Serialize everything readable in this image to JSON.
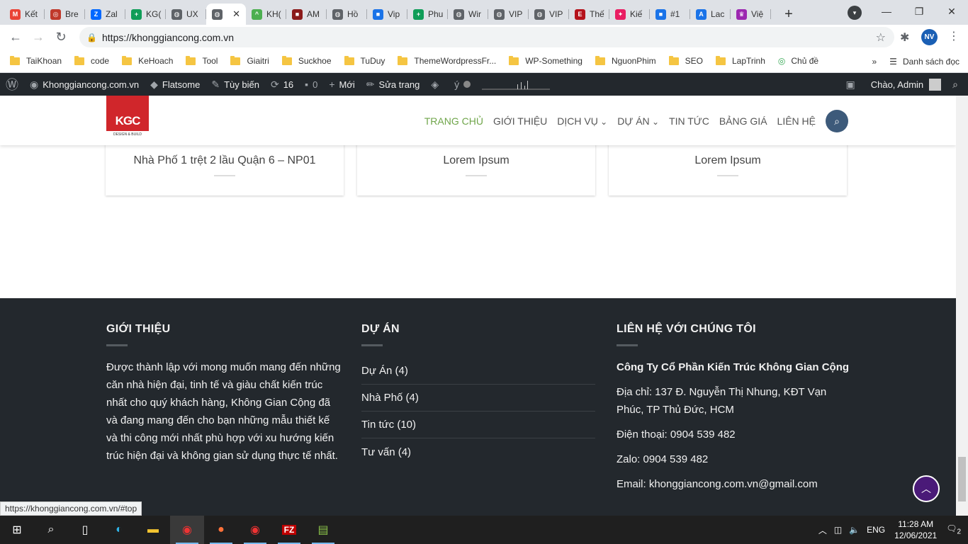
{
  "browser": {
    "tabs": [
      {
        "label": "Kết",
        "color": "#ea4335",
        "glyph": "M"
      },
      {
        "label": "Bre",
        "color": "#c0392b",
        "glyph": "◎"
      },
      {
        "label": "Zal",
        "color": "#0068ff",
        "glyph": "Z"
      },
      {
        "label": "KG(",
        "color": "#0f9d58",
        "glyph": "+"
      },
      {
        "label": "UX",
        "color": "#5f6368",
        "glyph": "◍"
      },
      {
        "label": "",
        "color": "#5f6368",
        "glyph": "◍",
        "active": true
      },
      {
        "label": "KH(",
        "color": "#4caf50",
        "glyph": "^"
      },
      {
        "label": "AM",
        "color": "#8b1a1a",
        "glyph": "■"
      },
      {
        "label": "Hồ",
        "color": "#5f6368",
        "glyph": "◍"
      },
      {
        "label": "Vip",
        "color": "#1a73e8",
        "glyph": "■"
      },
      {
        "label": "Phu",
        "color": "#0f9d58",
        "glyph": "+"
      },
      {
        "label": "Wir",
        "color": "#5f6368",
        "glyph": "◍"
      },
      {
        "label": "VIP",
        "color": "#5f6368",
        "glyph": "◍"
      },
      {
        "label": "VIP",
        "color": "#5f6368",
        "glyph": "◍"
      },
      {
        "label": "Thế",
        "color": "#b5121b",
        "glyph": "E"
      },
      {
        "label": "Kiế",
        "color": "#e91e63",
        "glyph": "✦"
      },
      {
        "label": "#1",
        "color": "#1a73e8",
        "glyph": "■"
      },
      {
        "label": "Lac",
        "color": "#1a73e8",
        "glyph": "A"
      },
      {
        "label": "Việ",
        "color": "#9c27b0",
        "glyph": "♛"
      }
    ],
    "url": "https://khonggiancong.com.vn",
    "profile_initials": "NV",
    "bookmarks": [
      "TaiKhoan",
      "code",
      "KeHoach",
      "Tool",
      "Giaitri",
      "Suckhoe",
      "TuDuy",
      "ThemeWordpressFr...",
      "WP-Something",
      "NguonPhim",
      "SEO",
      "LapTrinh"
    ],
    "bookmark_special": "Chủ đề",
    "reading_list": "Danh sách đọc",
    "status_url": "https://khonggiancong.com.vn/#top"
  },
  "adminbar": {
    "site": "Khonggiancong.com.vn",
    "theme": "Flatsome",
    "customize": "Tùy biến",
    "updates": "16",
    "comments": "0",
    "new": "Mới",
    "edit": "Sửa trang",
    "greeting": "Chào, Admin"
  },
  "site": {
    "logo_text": "KGC",
    "logo_tag": "DESIGN & BUILD",
    "nav": [
      "TRANG CHỦ",
      "GIỚI THIỆU",
      "DỊCH VỤ",
      "DỰ ÁN",
      "TIN TỨC",
      "BẢNG GIÁ",
      "LIÊN HỆ"
    ],
    "cards": [
      {
        "title": "Nhà Phố 1 trệt 2 lầu Quận 6 – NP01"
      },
      {
        "title": "Lorem Ipsum"
      },
      {
        "title": "Lorem Ipsum"
      }
    ]
  },
  "footer": {
    "about": {
      "heading": "GIỚI THIỆU",
      "text": "Được thành lập với mong muốn mang đến những căn nhà hiện đại, tinh tế và giàu chất kiến trúc nhất cho quý khách hàng, Không Gian Cộng đã và đang mang đến cho bạn những mẫu thiết kế và thi công mới nhất phù hợp với xu hướng kiến trúc hiện đại và không gian sử dụng thực tế nhất."
    },
    "projects": {
      "heading": "DỰ ÁN",
      "items": [
        "Dự Án (4)",
        "Nhà Phố (4)",
        "Tin tức (10)",
        "Tư vấn (4)"
      ]
    },
    "contact": {
      "heading": "LIÊN HỆ VỚI CHÚNG TÔI",
      "company": "Công Ty Cổ Phần Kiến Trúc Không Gian Cộng",
      "address": "Địa chỉ: 137 Đ. Nguyễn Thị Nhung, KĐT Vạn Phúc, TP Thủ Đức, HCM",
      "phone": "Điện thoại: 0904 539 482",
      "zalo": "Zalo: 0904 539 482",
      "email": "Email: khonggiancong.com.vn@gmail.com"
    }
  },
  "taskbar": {
    "lang": "ENG",
    "time": "11:28 AM",
    "date": "12/06/2021",
    "notifications": "2"
  },
  "colors": {
    "accent_green": "#6fa54a",
    "footer_bg": "#23282d",
    "totop": "#4a1a78"
  }
}
